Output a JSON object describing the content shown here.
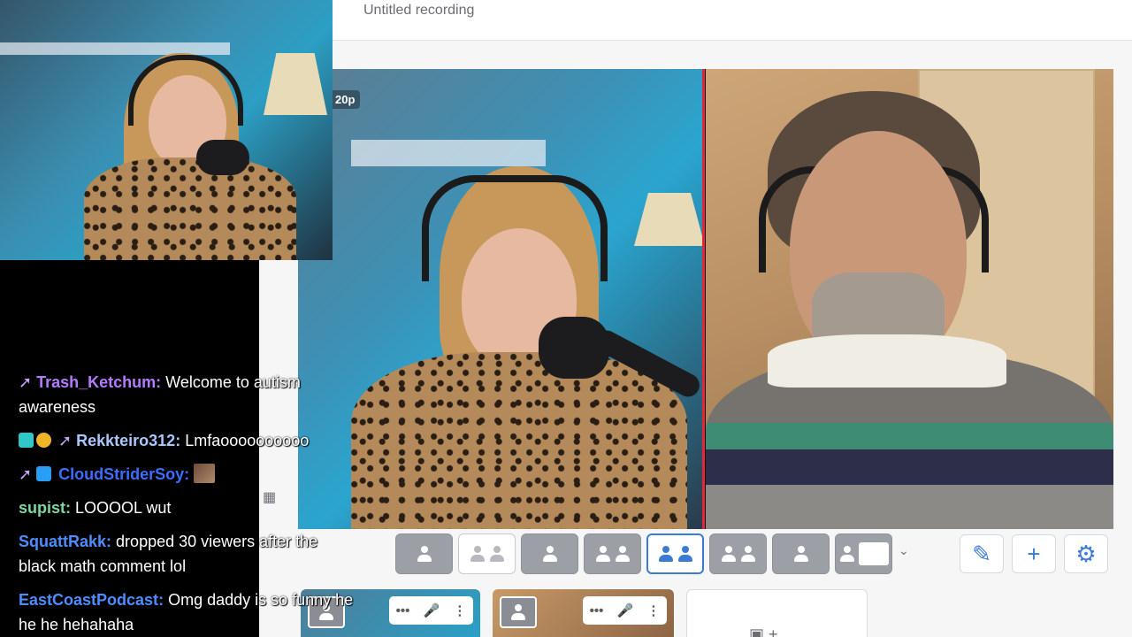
{
  "app": {
    "recording_title": "Untitled recording",
    "resolution_badge": "20p"
  },
  "layout_toolbar": {
    "options": [
      "solo",
      "thumbnail",
      "thumbnail-overlay",
      "group",
      "side-by-side",
      "cropped",
      "presenter",
      "screen-share"
    ],
    "active_index": 4,
    "more_icon": "chevron-down"
  },
  "tools": {
    "edit_icon": "pencil",
    "add_icon": "plus",
    "settings_icon": "gear"
  },
  "participants": [
    {
      "controls": "•••"
    },
    {
      "controls": "•••"
    }
  ],
  "chat": {
    "messages": [
      {
        "user": "Trash_Ketchum",
        "user_color": "#b57bff",
        "text": "Welcome to autism awareness"
      },
      {
        "user": "Rekkteiro312",
        "user_color": "#a9c7ff",
        "text": "Lmfaoooooooooo"
      },
      {
        "user": "CloudStriderSoy",
        "user_color": "#3d6dff",
        "text": ""
      },
      {
        "user": "supist",
        "user_color": "#7fd6a0",
        "text": "LOOOOL wut"
      },
      {
        "user": "SquattRakk",
        "user_color": "#4e8cff",
        "text": "dropped 30 viewers after the black math comment lol"
      },
      {
        "user": "EastCoastPodcast",
        "user_color": "#4e8cff",
        "text": "Omg daddy is so funny he he he hehahaha"
      }
    ]
  },
  "colors": {
    "accent": "#3a7bd5",
    "active_speaker_border": "#e0283a"
  }
}
